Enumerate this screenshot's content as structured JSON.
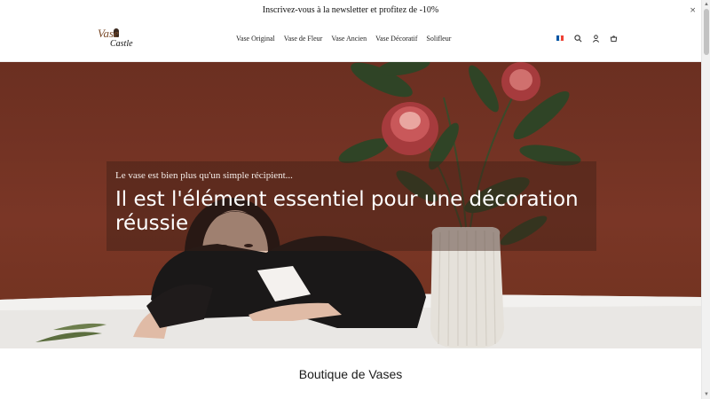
{
  "announcement": {
    "text": "Inscrivez-vous à la newsletter et profitez de -10%",
    "close_glyph": "×"
  },
  "header": {
    "logo": {
      "line1": "Vase",
      "line2": "Castle"
    },
    "nav": [
      {
        "label": "Vase Original"
      },
      {
        "label": "Vase de Fleur"
      },
      {
        "label": "Vase Ancien"
      },
      {
        "label": "Vase Décoratif"
      },
      {
        "label": "Solifleur"
      }
    ],
    "icons": [
      "france-flag-icon",
      "search-icon",
      "account-icon",
      "cart-icon"
    ],
    "flag_colors": [
      "#0055A4",
      "#FFFFFF",
      "#EF4135"
    ]
  },
  "hero": {
    "subtitle": "Le vase est bien plus qu'un simple récipient...",
    "title": "Il est l'élément essentiel pour une décoration réussie",
    "colors": {
      "wall": "#73331f",
      "table": "#e9e7e4",
      "vase": "#e5e1da"
    }
  },
  "section": {
    "title": "Boutique de Vases"
  }
}
